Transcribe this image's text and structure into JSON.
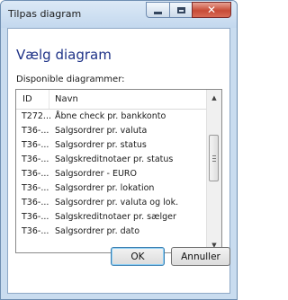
{
  "window": {
    "title": "Tilpas diagram",
    "close_symbol": "✕"
  },
  "dialog": {
    "heading": "Vælg diagram",
    "list_label": "Disponible diagrammer:"
  },
  "list": {
    "columns": {
      "id": "ID",
      "name": "Navn"
    },
    "rows": [
      {
        "id": "T272...",
        "name": "Åbne check pr. bankkonto"
      },
      {
        "id": "T36-...",
        "name": "Salgsordrer pr. valuta"
      },
      {
        "id": "T36-...",
        "name": "Salgsordrer pr. status"
      },
      {
        "id": "T36-...",
        "name": "Salgskreditnotaer pr. status"
      },
      {
        "id": "T36-...",
        "name": "Salgsordrer - EURO"
      },
      {
        "id": "T36-...",
        "name": "Salgsordrer pr. lokation"
      },
      {
        "id": "T36-...",
        "name": "Salgsordrer pr. valuta og lok."
      },
      {
        "id": "T36-...",
        "name": "Salgskreditnotaer pr. sælger"
      },
      {
        "id": "T36-...",
        "name": "Salgsordrer pr. dato"
      }
    ],
    "scroll_up_symbol": "▲",
    "scroll_down_symbol": "▼"
  },
  "buttons": {
    "ok": "OK",
    "cancel": "Annuller"
  }
}
